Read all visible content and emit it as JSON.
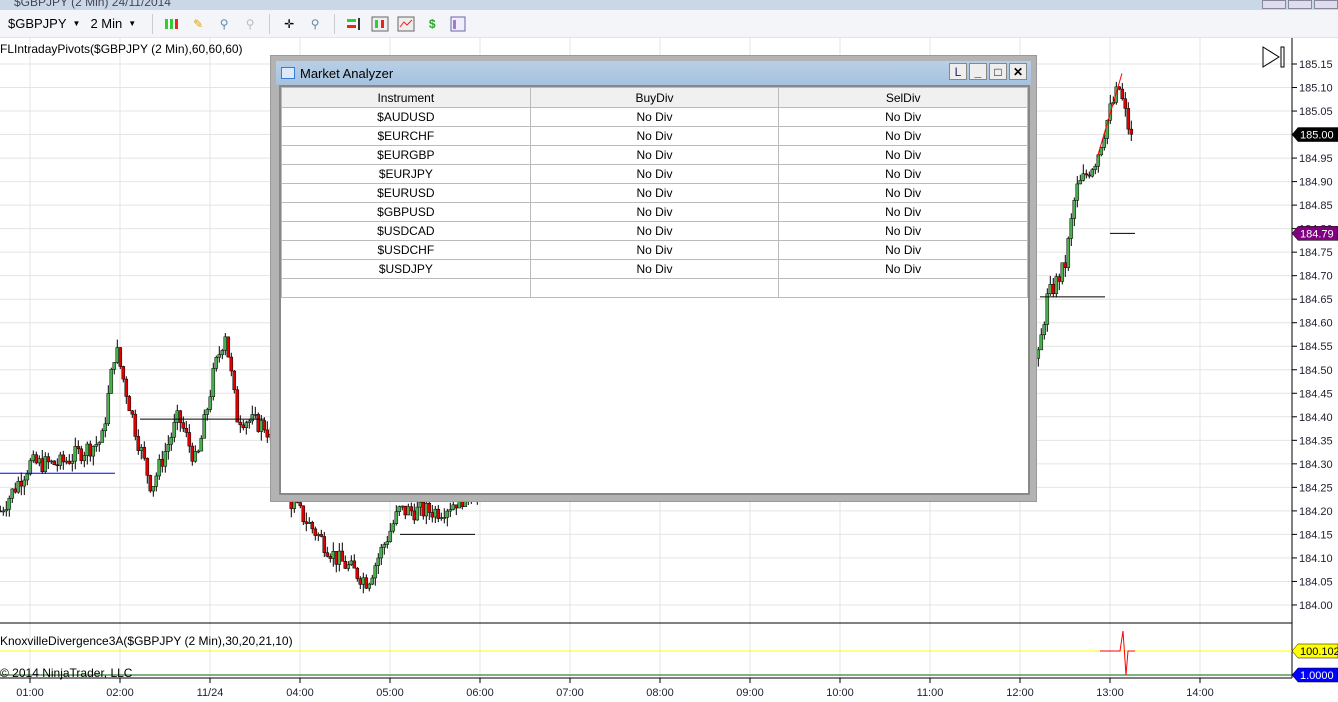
{
  "window": {
    "title": "$GBPJPY (2 Min)  24/11/2014"
  },
  "toolbar": {
    "instrument": "$GBPJPY",
    "interval": "2 Min",
    "icons": [
      "candlestick-style-icon",
      "pencil-draw-icon",
      "zoom-in-icon",
      "zoom-out-icon",
      "crosshair-icon",
      "magnifier-icon",
      "order-panel-icon",
      "data-series-icon",
      "indicators-icon",
      "strategy-icon",
      "properties-icon"
    ]
  },
  "chart": {
    "indicator_label": "FLIntradayPivots($GBPJPY (2 Min),60,60,60)",
    "sub_indicator_label": "KnoxvilleDivergence3A($GBPJPY (2 Min),30,20,21,10)",
    "copyright": "© 2014 NinjaTrader, LLC",
    "price_ticks": [
      "185.15",
      "185.10",
      "185.05",
      "185.00",
      "184.95",
      "184.90",
      "184.85",
      "184.80",
      "184.75",
      "184.70",
      "184.65",
      "184.60",
      "184.55",
      "184.50",
      "184.45",
      "184.40",
      "184.35",
      "184.30",
      "184.25",
      "184.20",
      "184.15",
      "184.10",
      "184.05",
      "184.00"
    ],
    "time_ticks": [
      "01:00",
      "02:00",
      "11/24",
      "04:00",
      "05:00",
      "06:00",
      "07:00",
      "08:00",
      "09:00",
      "10:00",
      "11:00",
      "12:00",
      "13:00",
      "14:00"
    ],
    "last_price": "185.00",
    "pivot_price": "184.79",
    "sub_values": [
      "100.102",
      "1.0000"
    ],
    "colors": {
      "up": "#4caf50",
      "down": "#e00000",
      "last": "#000000",
      "pivot": "#800080",
      "sub1": "#ffff00",
      "sub2": "#0000ff"
    },
    "price_path": [
      [
        0.67,
        184.2
      ],
      [
        1,
        184.3
      ],
      [
        1.33,
        184.3
      ],
      [
        1.8,
        184.35
      ],
      [
        1.95,
        184.55
      ],
      [
        2.2,
        184.35
      ],
      [
        2.35,
        184.25
      ],
      [
        2.65,
        184.4
      ],
      [
        2.85,
        184.3
      ],
      [
        3.05,
        184.5
      ],
      [
        3.17,
        184.58
      ],
      [
        3.3,
        184.4
      ],
      [
        3.62,
        184.38
      ],
      [
        3.9,
        184.22
      ],
      [
        4.4,
        184.1
      ],
      [
        4.75,
        184.05
      ],
      [
        5.1,
        184.2
      ],
      [
        5.55,
        184.2
      ],
      [
        6.0,
        184.25
      ],
      [
        12.2,
        184.52
      ],
      [
        12.3,
        184.65
      ],
      [
        12.5,
        184.72
      ],
      [
        12.62,
        184.88
      ],
      [
        12.85,
        184.95
      ],
      [
        13.0,
        185.05
      ],
      [
        13.1,
        185.1
      ],
      [
        13.25,
        184.98
      ]
    ]
  },
  "market_analyzer": {
    "title": "Market Analyzer",
    "buttons": [
      "L",
      "_",
      "□",
      "✕"
    ],
    "columns": [
      "Instrument",
      "BuyDiv",
      "SelDiv"
    ],
    "rows": [
      [
        "$AUDUSD",
        "No Div",
        "No Div"
      ],
      [
        "$EURCHF",
        "No Div",
        "No Div"
      ],
      [
        "$EURGBP",
        "No Div",
        "No Div"
      ],
      [
        "$EURJPY",
        "No Div",
        "No Div"
      ],
      [
        "$EURUSD",
        "No Div",
        "No Div"
      ],
      [
        "$GBPUSD",
        "No Div",
        "No Div"
      ],
      [
        "$USDCAD",
        "No Div",
        "No Div"
      ],
      [
        "$USDCHF",
        "No Div",
        "No Div"
      ],
      [
        "$USDJPY",
        "No Div",
        "No Div"
      ],
      [
        "",
        "",
        ""
      ]
    ]
  }
}
